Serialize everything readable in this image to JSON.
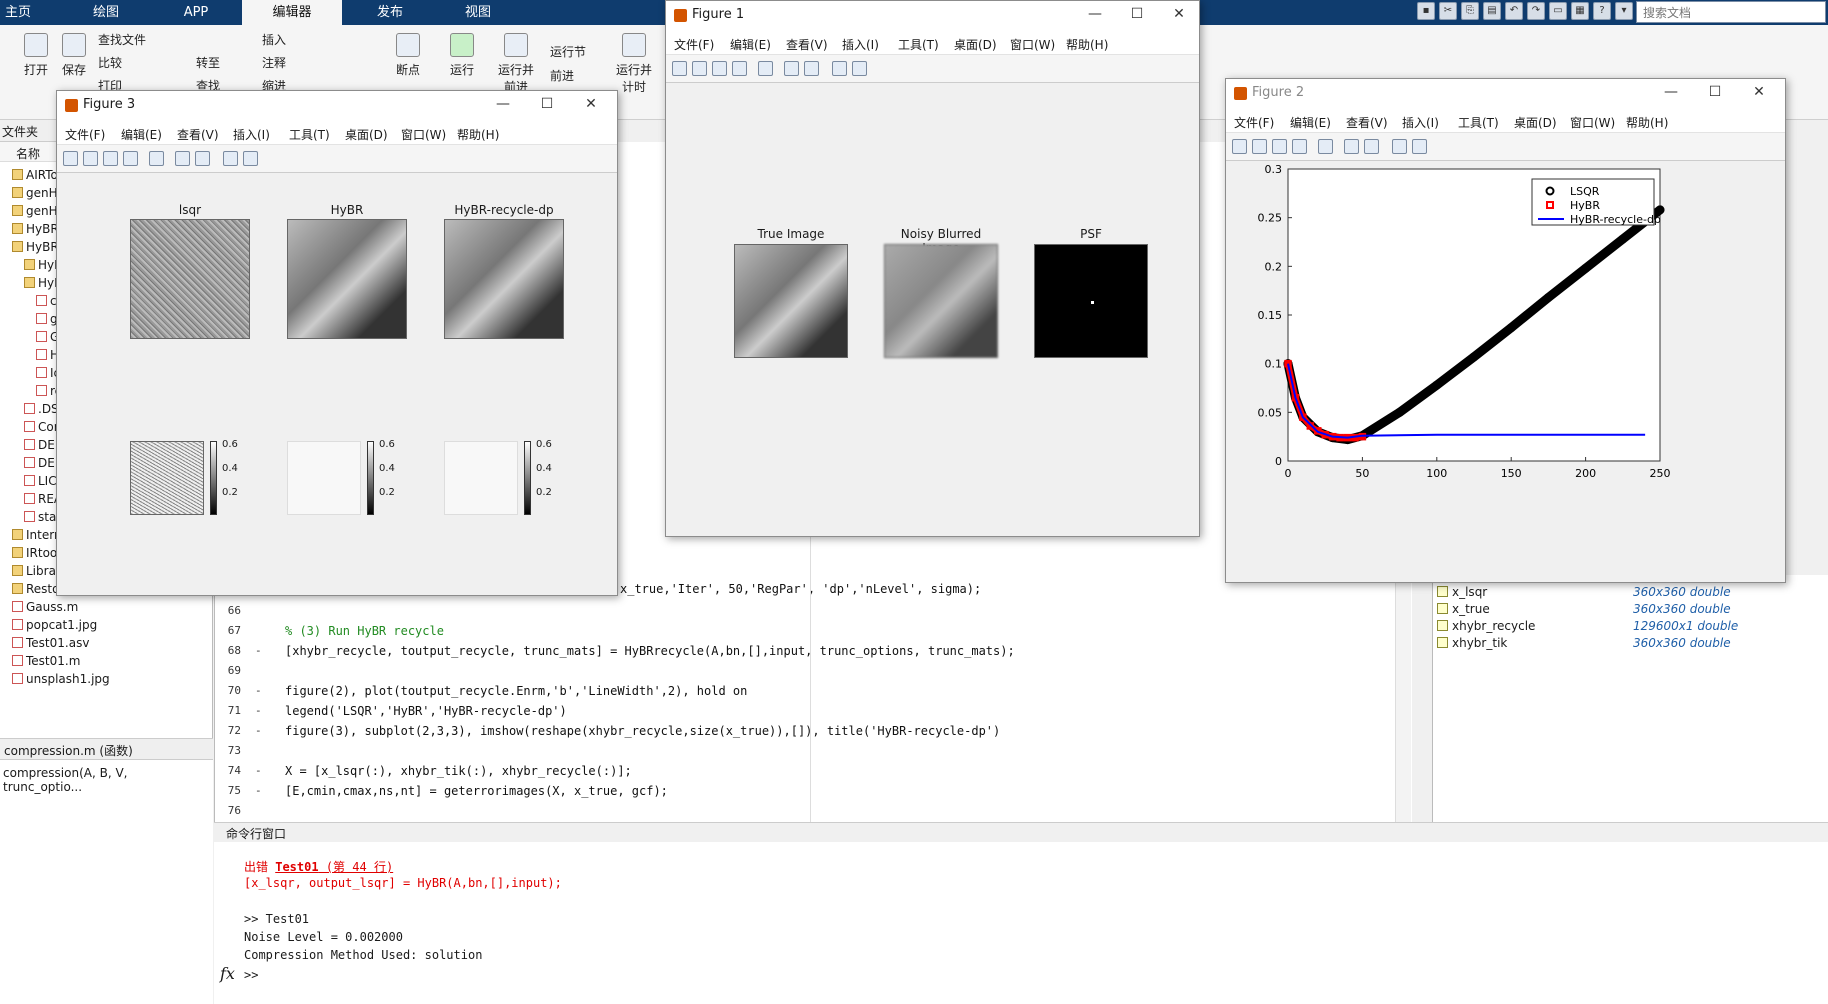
{
  "ribbon_tabs": [
    "主页",
    "绘图",
    "APP",
    "编辑器",
    "发布",
    "视图"
  ],
  "search_placeholder": "搜索文档",
  "ribbon": {
    "open": "打开",
    "save": "保存",
    "find_files": "查找文件",
    "compare": "比较",
    "print": "打印",
    "goto": "转至",
    "find": "查找",
    "insert": "插入",
    "comment": "注释",
    "indent": "缩进",
    "breakpoints": "断点",
    "run": "运行",
    "run_advance": "运行并\n前进",
    "run_section": "运行节",
    "advance": "前进",
    "run_time": "运行并\n计时"
  },
  "file_panel": {
    "path_label": "文件夹",
    "col_name": "名称",
    "items": [
      "AIRToo",
      "genHy",
      "genHyB",
      "HyBR",
      "HyBRre",
      "HyBR",
      "HyBR",
      "co",
      "ge",
      "Gi",
      "Hy",
      "Ic",
      "re",
      ".DS_S",
      "Cont",
      "DEM",
      "DEM",
      "LICE",
      "READ",
      "start",
      "Internet",
      "IRtools-",
      "Library",
      "RestoreTools",
      "Gauss.m",
      "popcat1.jpg",
      "Test01.asv",
      "Test01.m",
      "unsplash1.jpg"
    ],
    "detail_title": "compression.m  (函数)",
    "detail_sig": "compression(A, B, V, trunc_optio..."
  },
  "editor": {
    "lines": [
      {
        "n": "66",
        "d": "",
        "c": ""
      },
      {
        "n": "67",
        "d": "",
        "c": "% (3) Run HyBR recycle"
      },
      {
        "n": "68",
        "d": "-",
        "c": "[xhybr_recycle, toutput_recycle, trunc_mats] = HyBRrecycle(A,bn,[],input, trunc_options, trunc_mats);"
      },
      {
        "n": "69",
        "d": "",
        "c": ""
      },
      {
        "n": "70",
        "d": "-",
        "c": "figure(2), plot(toutput_recycle.Enrm,'b','LineWidth',2), hold on"
      },
      {
        "n": "71",
        "d": "-",
        "c": "legend('LSQR','HyBR','HyBR-recycle-dp')"
      },
      {
        "n": "72",
        "d": "-",
        "c": "figure(3), subplot(2,3,3), imshow(reshape(xhybr_recycle,size(x_true)),[]), title('HyBR-recycle-dp')"
      },
      {
        "n": "73",
        "d": "",
        "c": ""
      },
      {
        "n": "74",
        "d": "-",
        "c": "X = [x_lsqr(:), xhybr_tik(:), xhybr_recycle(:)];"
      },
      {
        "n": "75",
        "d": "-",
        "c": "[E,cmin,cmax,ns,nt] = geterrorimages(X, x_true, gcf);"
      },
      {
        "n": "76",
        "d": "",
        "c": ""
      }
    ],
    "partial_top": "x_true,'Iter', 50,'RegPar', 'dp','nLevel', sigma);"
  },
  "command": {
    "header": "命令行窗口",
    "err_prefix": "出错 ",
    "err_file": "Test01",
    "err_loc": " (第 44 行)",
    "err_line": "[x_lsqr, output_lsqr] = HyBR(A,bn,[],input);",
    "l1": ">> Test01",
    "l2": "Noise Level = 0.002000",
    "l3": "Compression Method Used: solution",
    "prompt": ">>"
  },
  "workspace": [
    {
      "name": "x_lsqr",
      "val": "360x360 double"
    },
    {
      "name": "x_true",
      "val": "360x360 double"
    },
    {
      "name": "xhybr_recycle",
      "val": "129600x1 double"
    },
    {
      "name": "xhybr_tik",
      "val": "360x360 double"
    }
  ],
  "fig_menu": [
    "文件(F)",
    "编辑(E)",
    "查看(V)",
    "插入(I)",
    "工具(T)",
    "桌面(D)",
    "窗口(W)",
    "帮助(H)"
  ],
  "fig3": {
    "title": "Figure 3",
    "t1": "lsqr",
    "t2": "HyBR",
    "t3": "HyBR-recycle-dp",
    "cb": [
      "0.6",
      "0.4",
      "0.2"
    ]
  },
  "fig1": {
    "title": "Figure 1",
    "t1": "True Image",
    "t2": "Noisy Blurred Image",
    "t3": "PSF"
  },
  "fig2": {
    "title": "Figure 2"
  },
  "chart_data": {
    "type": "line",
    "series": [
      {
        "name": "LSQR",
        "color": "#000000",
        "marker": "o",
        "x": [
          0,
          5,
          10,
          20,
          30,
          40,
          50,
          75,
          100,
          125,
          150,
          175,
          200,
          225,
          250
        ],
        "y": [
          0.1,
          0.065,
          0.045,
          0.03,
          0.024,
          0.022,
          0.026,
          0.05,
          0.078,
          0.107,
          0.137,
          0.168,
          0.198,
          0.228,
          0.258
        ]
      },
      {
        "name": "HyBR",
        "color": "#ff0000",
        "marker": "s",
        "x": [
          0,
          5,
          10,
          15,
          20,
          25,
          30,
          35,
          40,
          45,
          50
        ],
        "y": [
          0.1,
          0.065,
          0.045,
          0.036,
          0.031,
          0.027,
          0.025,
          0.024,
          0.024,
          0.024,
          0.025
        ]
      },
      {
        "name": "HyBR-recycle-dp",
        "color": "#0000ff",
        "marker": "none",
        "x": [
          0,
          5,
          10,
          20,
          30,
          40,
          50,
          100,
          150,
          200,
          240
        ],
        "y": [
          0.1,
          0.065,
          0.045,
          0.03,
          0.025,
          0.024,
          0.026,
          0.027,
          0.027,
          0.027,
          0.027
        ]
      }
    ],
    "xlim": [
      0,
      250
    ],
    "ylim": [
      0,
      0.3
    ],
    "xticks": [
      "0",
      "50",
      "100",
      "150",
      "200",
      "250"
    ],
    "yticks": [
      "0",
      "0.05",
      "0.1",
      "0.15",
      "0.2",
      "0.25",
      "0.3"
    ],
    "legend": "top-right"
  }
}
